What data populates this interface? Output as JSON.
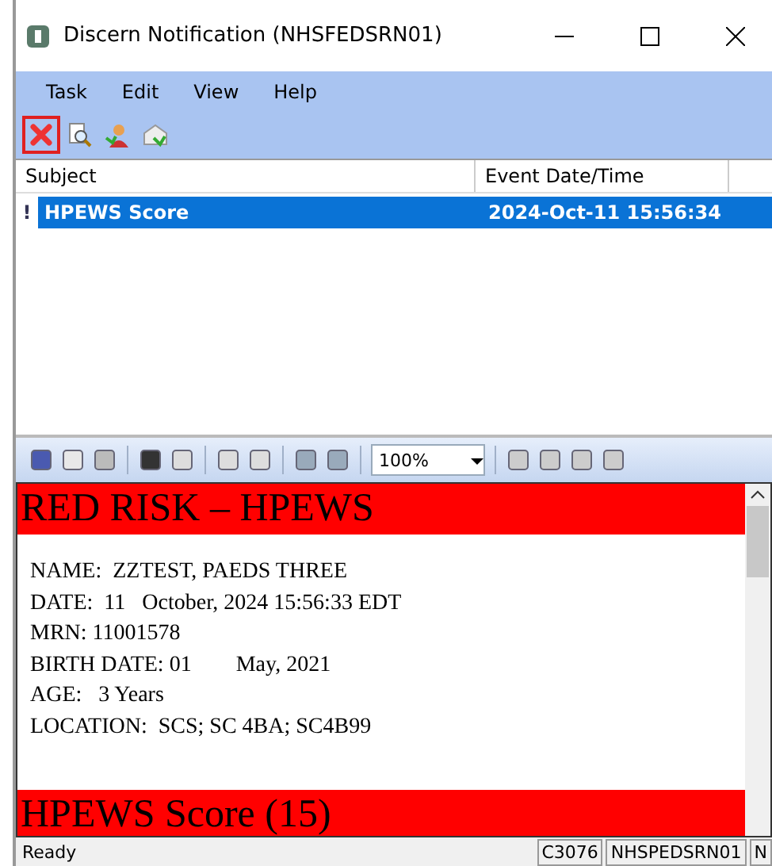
{
  "window": {
    "title": "Discern Notification (NHSFEDSRN01)"
  },
  "menu": [
    "Task",
    "Edit",
    "View",
    "Help"
  ],
  "toolbar": [
    {
      "kind": "close",
      "highlighted": true
    },
    {
      "kind": "preview",
      "highlighted": false
    },
    {
      "kind": "person",
      "highlighted": false
    },
    {
      "kind": "mail",
      "highlighted": false
    }
  ],
  "list": {
    "columns": [
      "Subject",
      "Event Date/Time"
    ],
    "rows": [
      {
        "priority": "!",
        "subject": "HPEWS Score",
        "time": "2024-Oct-11 15:56:34",
        "selected": true
      }
    ]
  },
  "viewer_toolbar": {
    "zoom": "100%"
  },
  "document": {
    "banner": "RED RISK – HPEWS",
    "lines": [
      "NAME:  ZZTEST, PAEDS THREE",
      "DATE:  11   October, 2024 15:56:33 EDT",
      "MRN: 11001578",
      "BIRTH DATE: 01        May, 2021",
      "AGE:   3 Years",
      "LOCATION:  SCS; SC 4BA; SC4B99"
    ],
    "section": "HPEWS Score (15)"
  },
  "status_bar": {
    "message": "Ready",
    "panels": [
      "C3076",
      "NHSPEDSRN01",
      "N"
    ]
  }
}
